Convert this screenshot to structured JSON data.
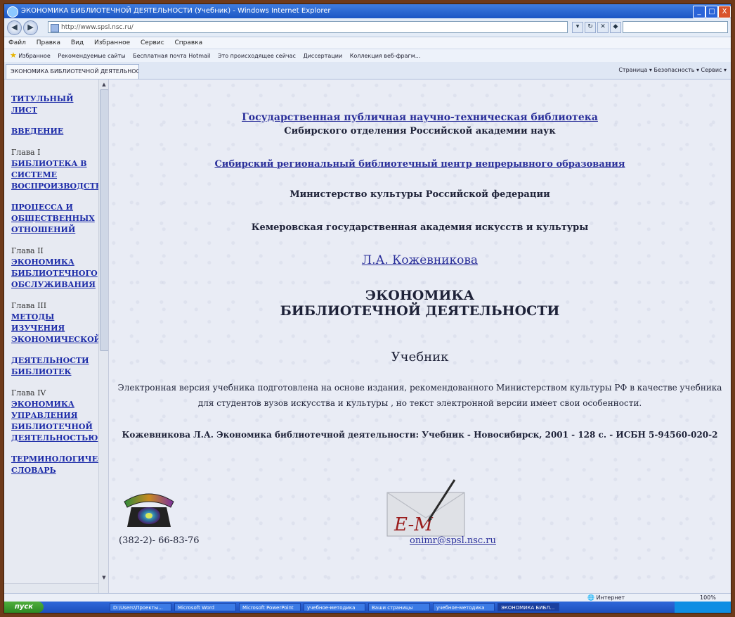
{
  "window": {
    "title": "ЭКОНОМИКА БИБЛИОТЕЧНОЙ ДЕЯТЕЛЬНОСТИ (Учебник) - Windows Internet Explorer",
    "min": "_",
    "max": "□",
    "close": "X"
  },
  "browser": {
    "back": "◀",
    "forward": "▶",
    "address": "http://www.spsl.nsc.ru/",
    "menu": [
      "Файл",
      "Правка",
      "Вид",
      "Избранное",
      "Сервис",
      "Справка"
    ],
    "favorites_label": "Избранное",
    "favorites": [
      "Рекомендуемые сайты",
      "Бесплатная почта Hotmail",
      "Это происходящее сейчас",
      "Диссертации",
      "Коллекция веб-фрагм..."
    ],
    "tab_title": "ЭКОНОМИКА БИБЛИОТЕЧНОЙ ДЕЯТЕЛЬНОСТИ (У...",
    "tools": "Страница ▾   Безопасность ▾   Сервис ▾",
    "status": "Интернет",
    "zoom": "100%"
  },
  "sidebar": {
    "groups": [
      {
        "label": "",
        "link": "ТИТУЛЬНЫЙ ЛИСТ"
      },
      {
        "label": "",
        "link": "ВВЕДЕНИЕ"
      },
      {
        "label": "Глава I",
        "link": "БИБЛИОТЕКА В СИСТЕМЕ ВОСПРОИЗВОДСТВА"
      },
      {
        "label": "",
        "link": "ПРОЦЕССА И ОБЩЕСТВЕННЫХ ОТНОШЕНИЙ"
      },
      {
        "label": "Глава II",
        "link": "ЭКОНОМИКА БИБЛИОТЕЧНОГО ОБСЛУЖИВАНИЯ"
      },
      {
        "label": "Глава III",
        "link": "МЕТОДЫ ИЗУЧЕНИЯ ЭКОНОМИЧЕСКОЙ"
      },
      {
        "label": "",
        "link": "ДЕЯТЕЛЬНОСТИ БИБЛИОТЕК"
      },
      {
        "label": "Глава IV",
        "link": "ЭКОНОМИКА УПРАВЛЕНИЯ БИБЛИОТЕЧНОЙ ДЕЯТЕЛЬНОСТЬЮ"
      },
      {
        "label": "",
        "link": "ТЕРМИНОЛОГИЧЕСКИЙ СЛОВАРЬ"
      }
    ]
  },
  "main": {
    "org1_line1": "Государственная публичная научно-техническая библиотека",
    "org1_line2": "Сибирского отделения Российской академии наук",
    "org2": "Сибирский региональный библиотечный центр непрерывного образования",
    "org3": "Министерство культуры Российской федерации",
    "org4": "Кемеровская государственная академия искусств и культуры",
    "author": "Л.А. Кожевникова",
    "title_line1": "ЭКОНОМИКА",
    "title_line2": "БИБЛИОТЕЧНОЙ ДЕЯТЕЛЬНОСТИ",
    "subtitle": "Учебник",
    "note_line1": "Электронная версия учебника подготовлена на основе издания, рекомендованного Министерством культуры РФ в качестве учебника",
    "note_line2": "для студентов вузов искусства и культуры , но текст электронной версии имеет свои особенности.",
    "citation": "Кожевникова Л.А. Экономика библиотечной деятельности: Учебник - Новосибирск, 2001 - 128 с. - ИСБН 5-94560-020-2",
    "phone": "(382-2)- 66-83-76",
    "email": "onimr@spsl.nsc.ru",
    "email_icon_text": "E-M"
  },
  "taskbar": {
    "start": "пуск",
    "items": [
      "D:\\Users\\Проекты...",
      "Microsoft Word",
      "Microsoft PowerPoint",
      "учебное-методика",
      "Ваши страницы",
      "учебное-методика",
      "ЭКОНОМИКА БИБЛ..."
    ]
  }
}
